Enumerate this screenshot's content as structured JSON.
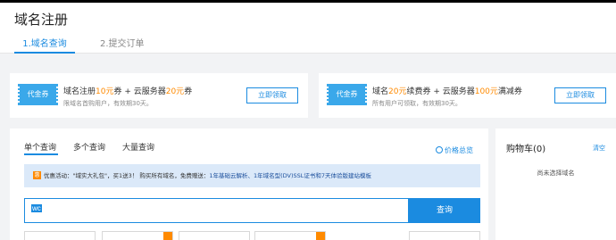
{
  "header": {
    "title": "域名注册",
    "steps": [
      {
        "label": "1.域名查询",
        "active": true
      },
      {
        "label": "2.提交订单",
        "active": false
      }
    ]
  },
  "promos": [
    {
      "badge": "代金券",
      "main_parts": [
        "域名注册",
        "10元",
        "券 + 云服务器",
        "20元",
        "券"
      ],
      "sub": "限域名首购用户，有效期30天。",
      "button": "立即领取"
    },
    {
      "badge": "代金券",
      "main_parts": [
        "域名",
        "20元",
        "续费券 + 云服务器",
        "100元",
        "满减券"
      ],
      "sub": "所有用户可领取，有效期30天。",
      "button": "立即领取"
    }
  ],
  "query": {
    "tabs": [
      "单个查询",
      "多个查询",
      "大量查询"
    ],
    "price_link": "价格总览",
    "notice": {
      "badge": "惠",
      "text": "优惠活动：\"域实大礼包\"，买1送3！ 购买所有域名，免费赠送：",
      "highlight": "1年基础云解析、1年域名型(DV)SSL证书和7天体验版建站模板"
    },
    "search_value": "wc",
    "search_button": "查询"
  },
  "cart": {
    "title": "购物车(0)",
    "clear": "清空",
    "empty_text": "尚未选择域名"
  },
  "colors": {
    "accent": "#1b8be0",
    "highlight": "#ff8a00",
    "notice_bg": "#dbe9f9"
  }
}
